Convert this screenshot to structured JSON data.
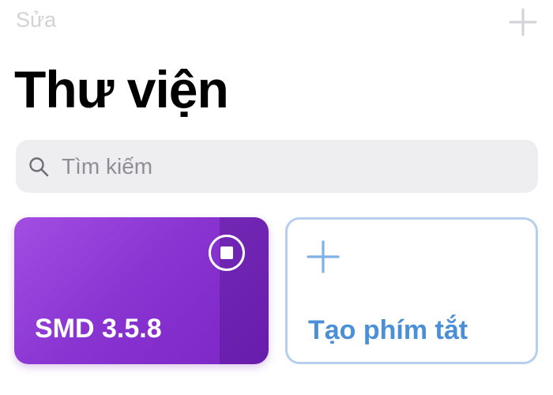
{
  "nav": {
    "edit_label": "Sửa",
    "add_icon": "plus-icon"
  },
  "header": {
    "title": "Thư viện"
  },
  "search": {
    "placeholder": "Tìm kiếm",
    "value": "",
    "icon": "search-icon"
  },
  "shortcuts": [
    {
      "title": "SMD 3.5.8",
      "action_icon": "stop-icon",
      "gradient": [
        "#a24ee2",
        "#7a25c5"
      ]
    }
  ],
  "create_card": {
    "label": "Tạo phím tắt",
    "icon": "plus-icon"
  },
  "colors": {
    "accent": "#4b8fd9",
    "card_border": "#b4d0ee",
    "nav_disabled": "#d2d2d7",
    "search_background": "#eeeef0"
  }
}
